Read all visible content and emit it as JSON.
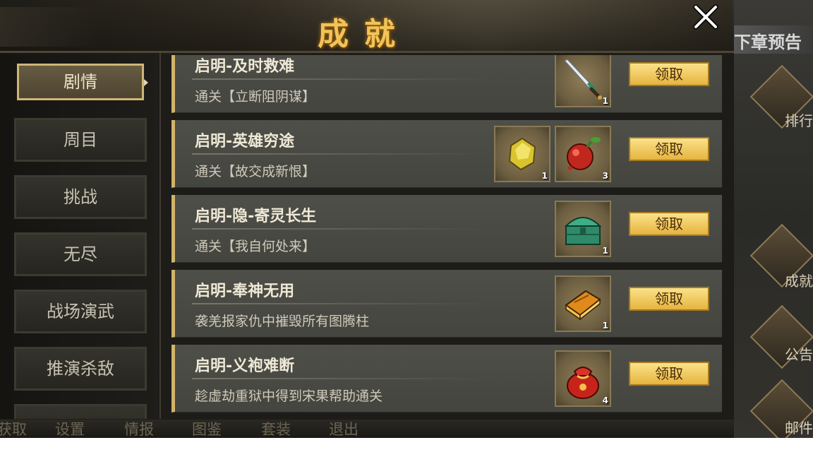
{
  "panel": {
    "title": "成就"
  },
  "tabs": [
    {
      "label": "剧情",
      "active": true
    },
    {
      "label": "周目"
    },
    {
      "label": "挑战"
    },
    {
      "label": "无尽"
    },
    {
      "label": "战场演武"
    },
    {
      "label": "推演杀敌"
    }
  ],
  "achievements": [
    {
      "title": "启明-及时救难",
      "desc": "通关【立断阻阴谋】",
      "claim": "领取",
      "rewards": [
        {
          "icon": "sword-icon",
          "count": "1"
        }
      ]
    },
    {
      "title": "启明-英雄穷途",
      "desc": "通关【故交成新恨】",
      "claim": "领取",
      "rewards": [
        {
          "icon": "gold-ore-icon",
          "count": "1"
        },
        {
          "icon": "red-fruit-icon",
          "count": "3"
        }
      ]
    },
    {
      "title": "启明-隐-寄灵长生",
      "desc": "通关【我自何处来】",
      "claim": "领取",
      "rewards": [
        {
          "icon": "jade-chest-icon",
          "count": "1"
        }
      ]
    },
    {
      "title": "启明-奉神无用",
      "desc": "袭羌报家仇中摧毁所有图腾柱",
      "claim": "领取",
      "rewards": [
        {
          "icon": "book-icon",
          "count": "1"
        }
      ]
    },
    {
      "title": "启明-义袍难断",
      "desc": "趁虚劫重狱中得到宋果帮助通关",
      "claim": "领取",
      "rewards": [
        {
          "icon": "red-pouch-icon",
          "count": "4"
        }
      ]
    }
  ],
  "background": {
    "next_chapter": "下章预告",
    "side_labels": [
      "排行",
      "成就",
      "公告",
      "邮件"
    ],
    "bottom_nav": [
      "获取",
      "设置",
      "情报",
      "图鉴",
      "套装",
      "退出"
    ]
  },
  "colors": {
    "accent_gold": "#f2c35a",
    "claim_button": "#f2cf62",
    "row_border": "#d2b46a"
  }
}
